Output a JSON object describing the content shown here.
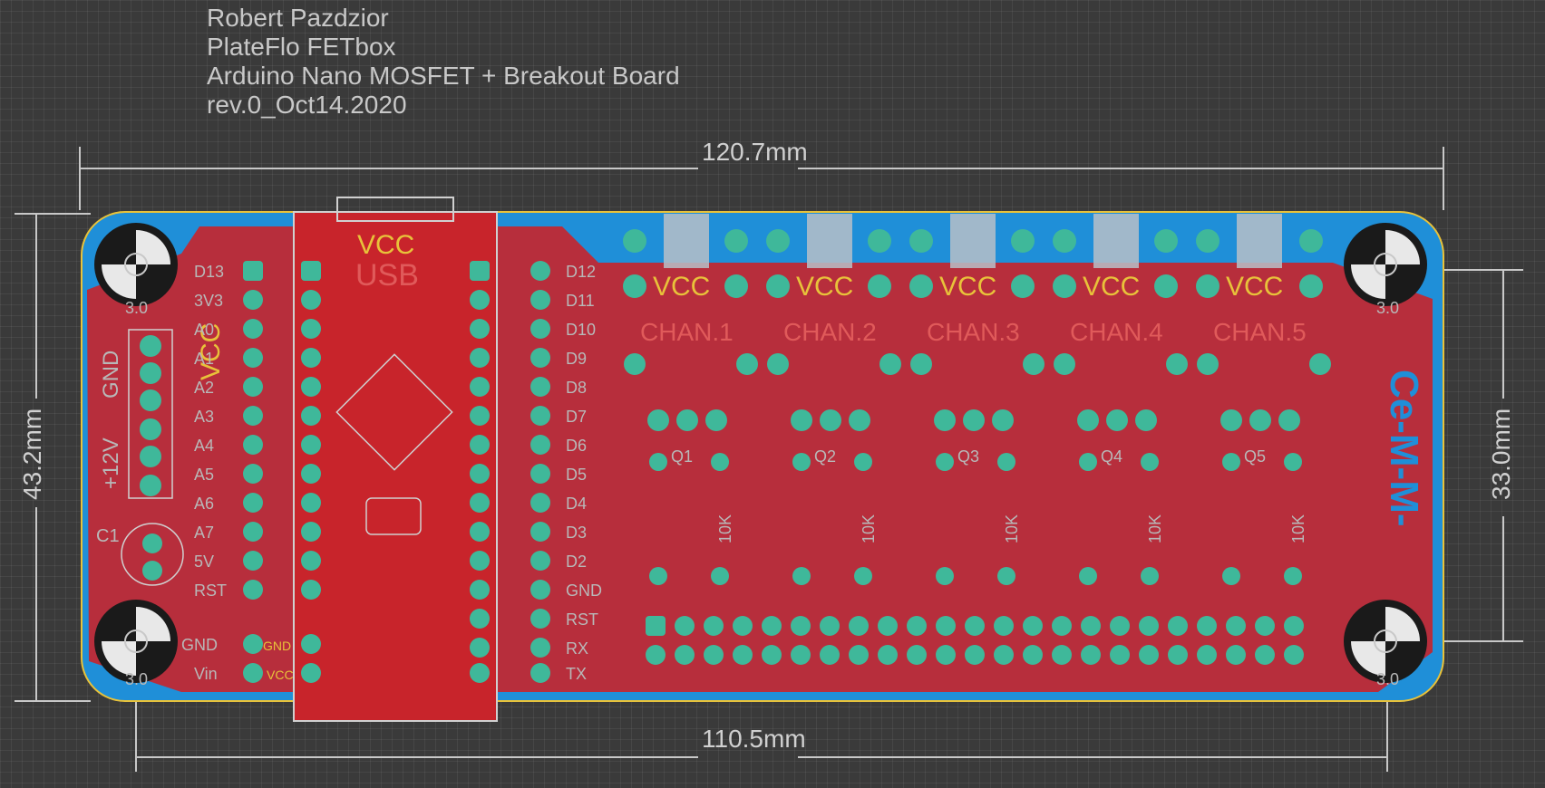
{
  "title_block": {
    "line1": "Robert Pazdzior",
    "line2": "PlateFlo FETbox",
    "line3": "Arduino Nano MOSFET + Breakout Board",
    "line4": "rev.0_Oct14.2020"
  },
  "dimensions": {
    "width_top": "120.7mm",
    "width_bottom": "110.5mm",
    "height_left": "43.2mm",
    "height_right": "33.0mm"
  },
  "board": {
    "vcc_label": "VCC",
    "usb_label": "USB",
    "hole_label": "3.0",
    "gnd_label": "GND",
    "power_label": "+12V",
    "cap_label": "C1",
    "logo_text": "Ce-M-M-",
    "left_header_pins": [
      "D13",
      "3V3",
      "A0",
      "A1",
      "A2",
      "A3",
      "A4",
      "A5",
      "A6",
      "A7",
      "5V",
      "RST",
      "GND",
      "Vin"
    ],
    "right_header_pins": [
      "D12",
      "D11",
      "D10",
      "D9",
      "D8",
      "D7",
      "D6",
      "D5",
      "D4",
      "D3",
      "D2",
      "GND",
      "RST",
      "RX",
      "TX"
    ],
    "channels": [
      "CHAN.1",
      "CHAN.2",
      "CHAN.3",
      "CHAN.4",
      "CHAN.5"
    ],
    "mosfets": [
      "Q1",
      "Q2",
      "Q3",
      "Q4",
      "Q5"
    ],
    "resistor_value": "10K",
    "pad_gnd": "GND",
    "pad_vcc": "VCC"
  },
  "colors": {
    "background": "#3a3a3a",
    "copper_top": "#c8242b",
    "copper_bottom": "#1f8fd8",
    "pad": "#3fb89a",
    "silkscreen": "#e8c23a",
    "dimension": "#d0d0d0"
  }
}
